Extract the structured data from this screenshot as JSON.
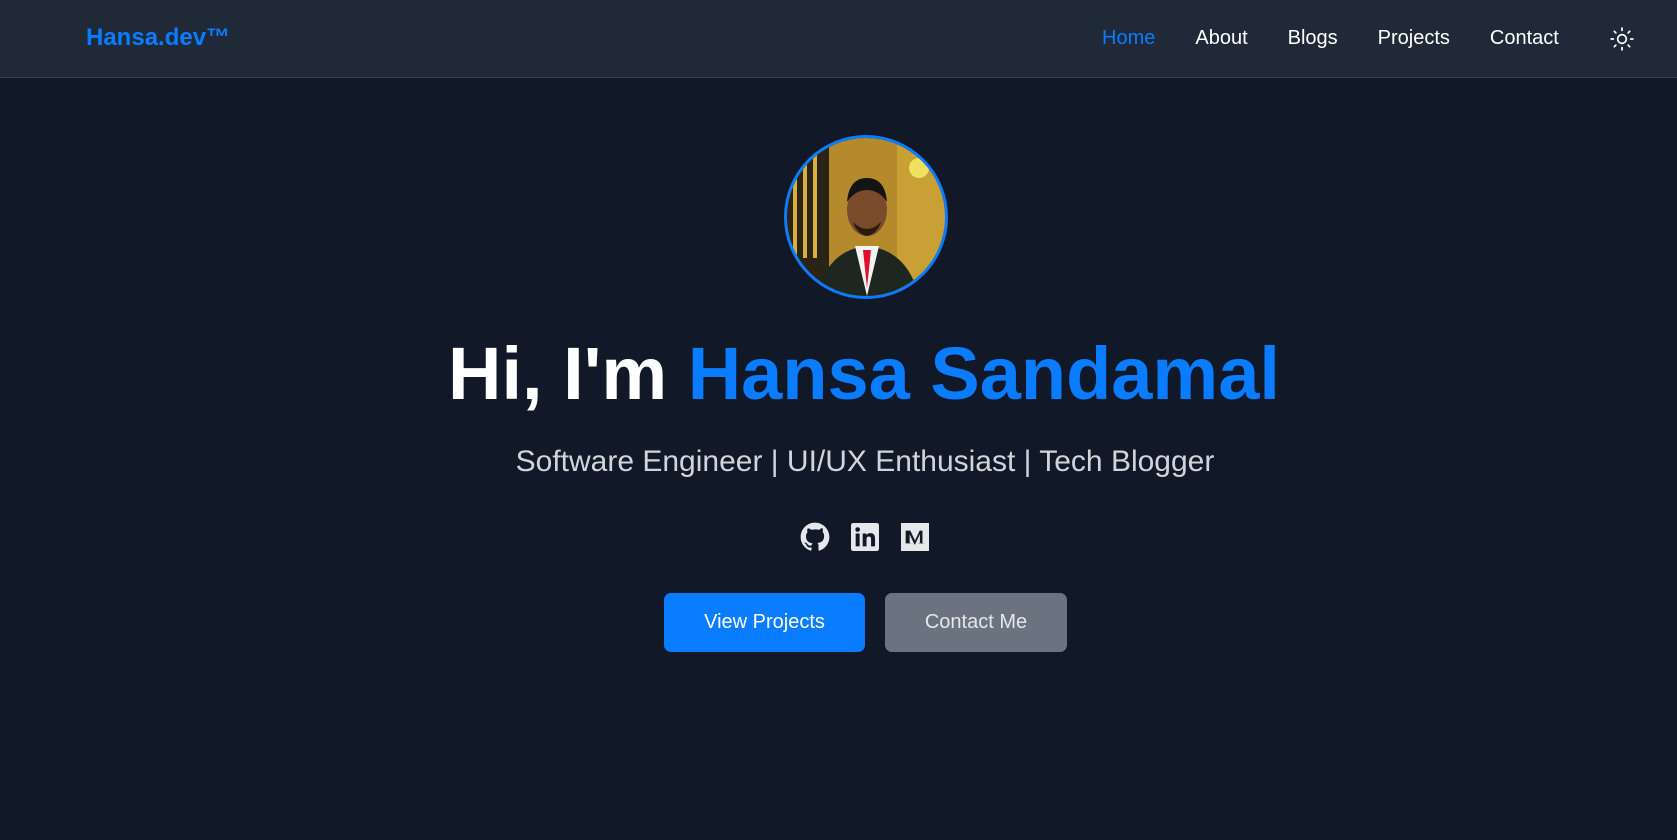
{
  "navbar": {
    "brand": "Hansa.dev™",
    "links": [
      {
        "label": "Home",
        "active": true
      },
      {
        "label": "About",
        "active": false
      },
      {
        "label": "Blogs",
        "active": false
      },
      {
        "label": "Projects",
        "active": false
      },
      {
        "label": "Contact",
        "active": false
      }
    ],
    "theme_toggle_icon": "sun-icon"
  },
  "hero": {
    "avatar": "profile-photo",
    "greeting": "Hi, I'm ",
    "name": "Hansa Sandamal",
    "subtitle": "Software Engineer | UI/UX Enthusiast | Tech Blogger",
    "socials": [
      {
        "icon": "github-icon"
      },
      {
        "icon": "linkedin-icon"
      },
      {
        "icon": "medium-icon"
      }
    ],
    "buttons": {
      "primary": "View Projects",
      "secondary": "Contact Me"
    }
  },
  "colors": {
    "background": "#111827",
    "navbar": "#1f2937",
    "accent": "#0a7cff",
    "secondary_button": "#6b7280"
  }
}
